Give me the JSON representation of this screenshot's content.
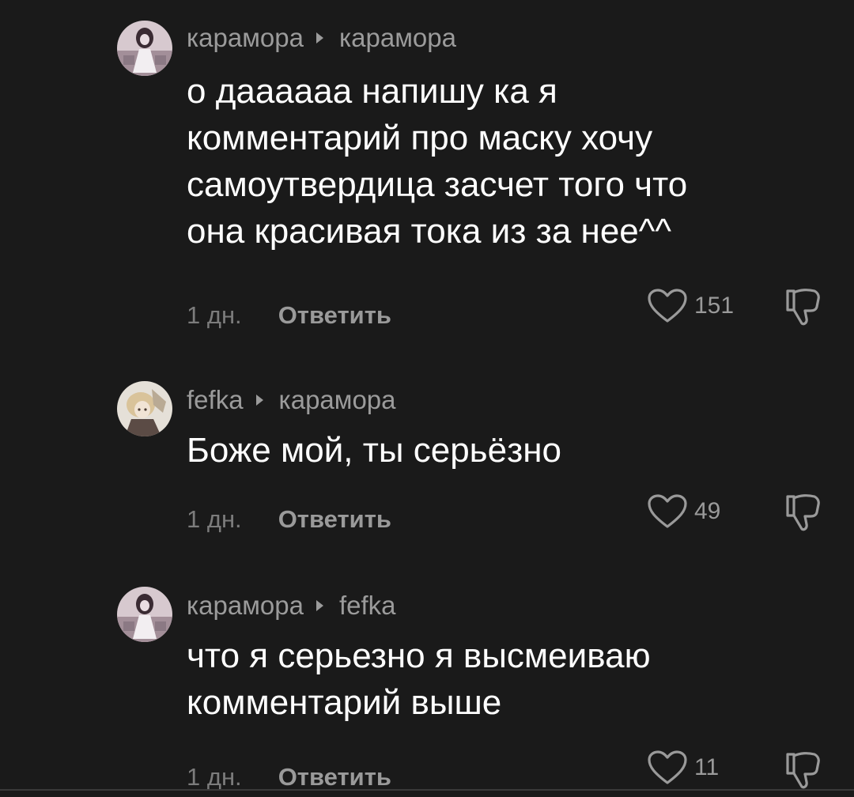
{
  "comments": [
    {
      "author": "карамора",
      "reply_to": "карамора",
      "text_lines": [
        "о даааааа напишу ка я",
        "комментарий про маску хочу",
        "самоутвердица засчет того что",
        "она красивая тока из за нее^^"
      ],
      "time": "1 дн.",
      "reply_label": "Ответить",
      "likes": "151"
    },
    {
      "author": "fefka",
      "reply_to": "карамора",
      "text_lines": [
        "Боже мой, ты серьёзно"
      ],
      "time": "1 дн.",
      "reply_label": "Ответить",
      "likes": "49"
    },
    {
      "author": "карамора",
      "reply_to": "fefka",
      "text_lines": [
        "что я серьезно я высмеиваю",
        "комментарий выше"
      ],
      "time": "1 дн.",
      "reply_label": "Ответить",
      "likes": "11"
    }
  ],
  "icons": {
    "reply_arrow": "play-triangle-icon",
    "like": "heart-outline-icon",
    "dislike": "thumbs-down-icon"
  },
  "colors": {
    "background": "#1a1a1a",
    "username": "#9b9b9b",
    "text": "#ffffff",
    "muted": "#7c7c7c"
  }
}
